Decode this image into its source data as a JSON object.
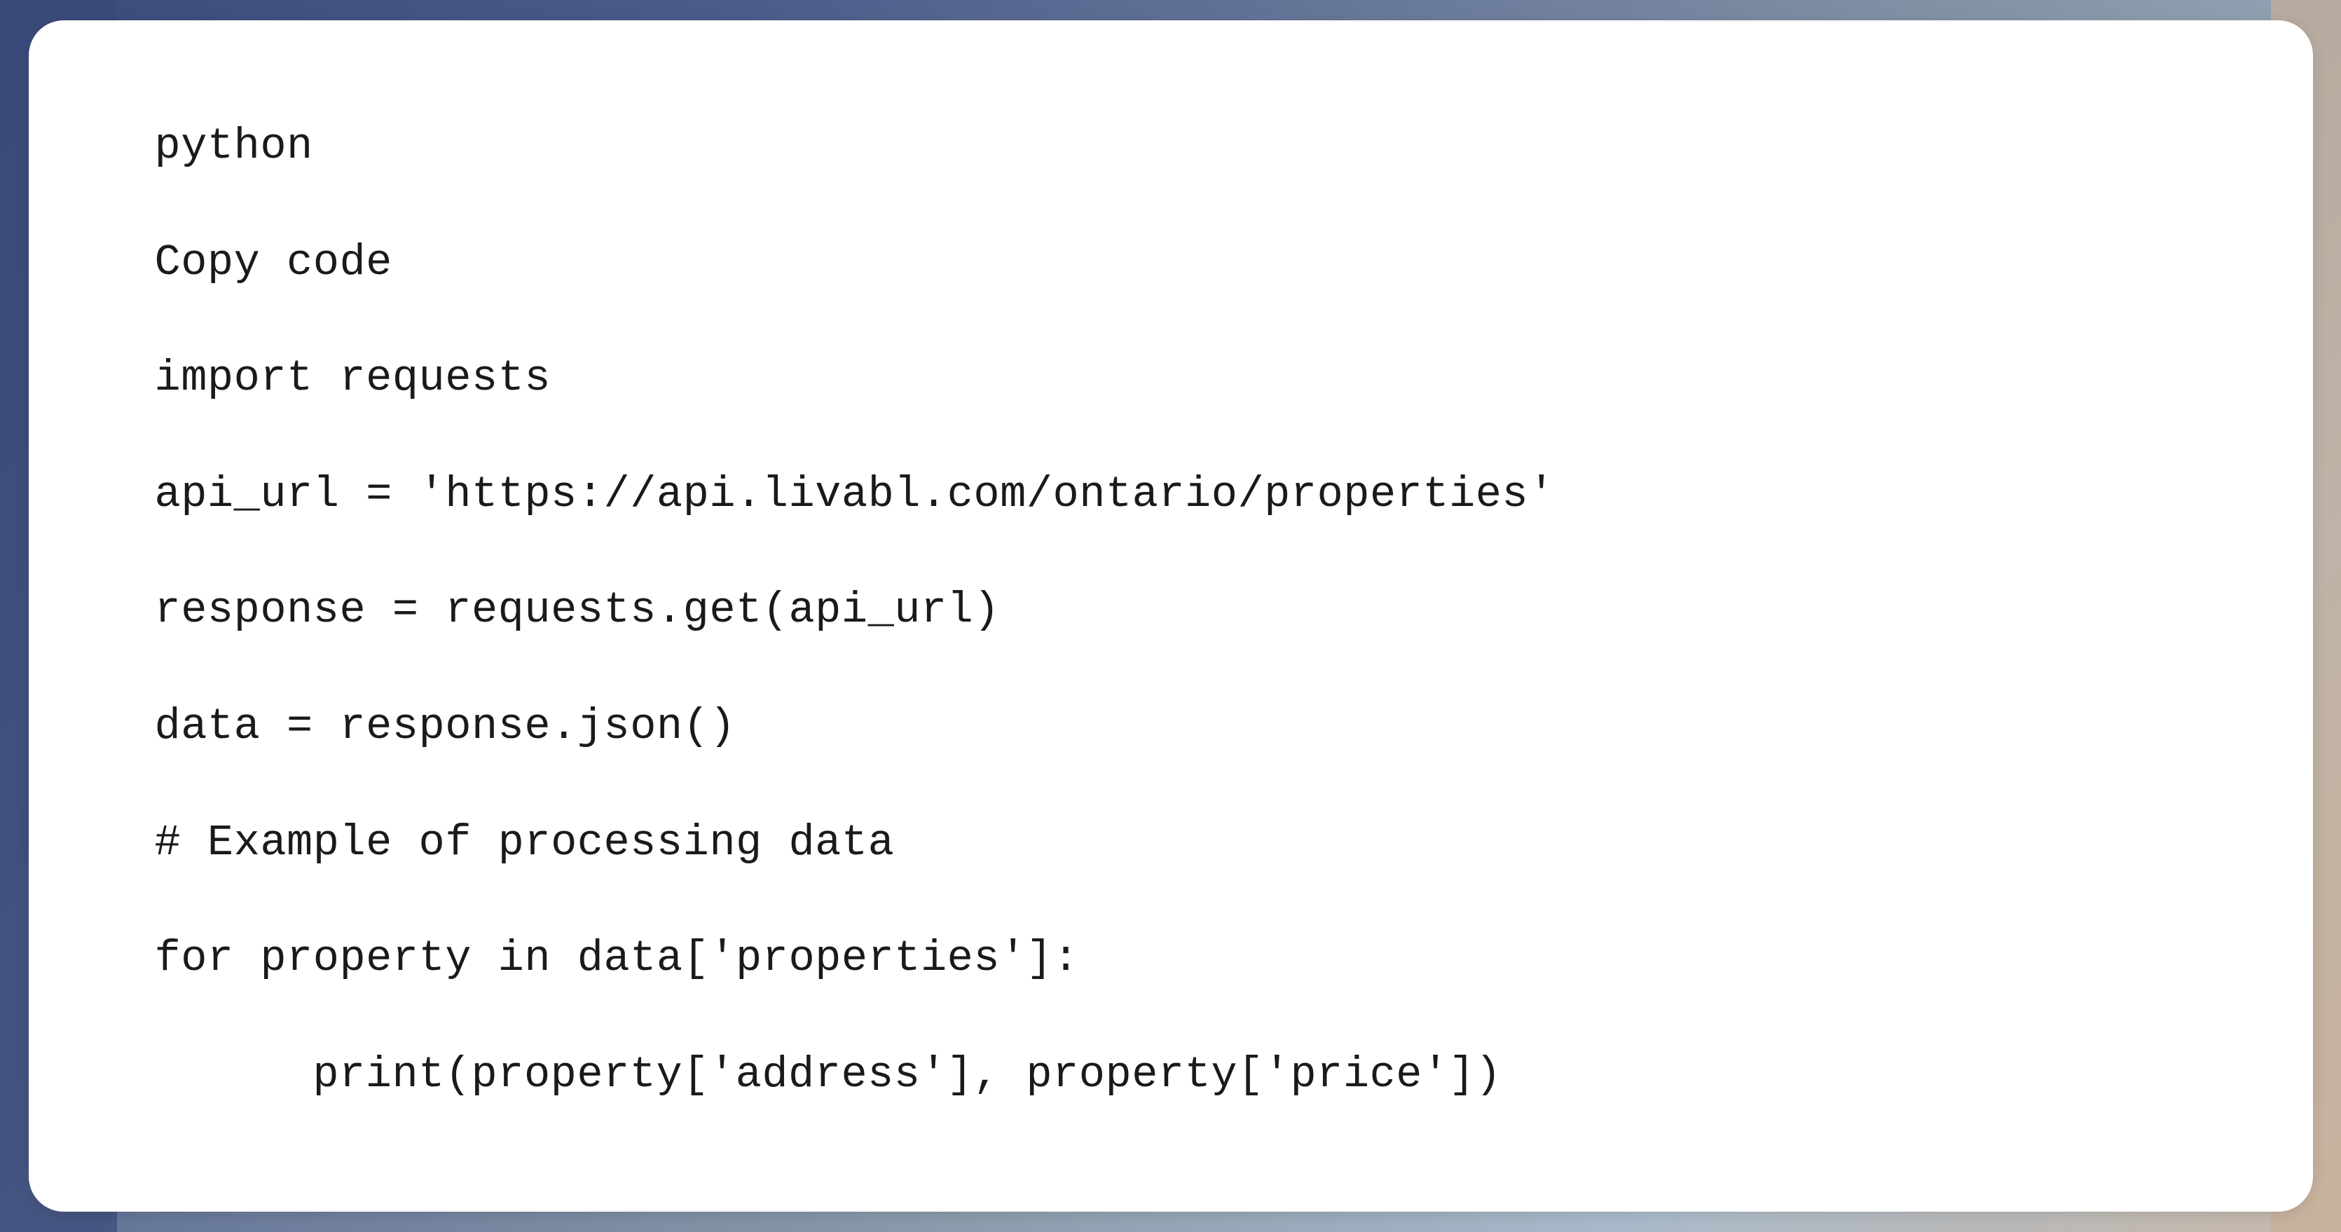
{
  "code": {
    "lines": [
      "python",
      "Copy code",
      "import requests",
      "api_url = 'https://api.livabl.com/ontario/properties'",
      "response = requests.get(api_url)",
      "data = response.json()",
      "# Example of processing data",
      "for property in data['properties']:",
      "    print(property['address'], property['price'])"
    ]
  }
}
